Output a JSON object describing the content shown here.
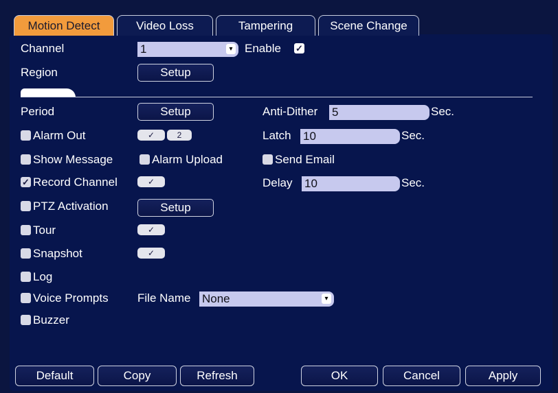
{
  "tabs": [
    "Motion Detect",
    "Video Loss",
    "Tampering",
    "Scene Change"
  ],
  "labels": {
    "channel": "Channel",
    "enable": "Enable",
    "region": "Region",
    "period": "Period",
    "anti_dither": "Anti-Dither",
    "latch": "Latch",
    "delay": "Delay",
    "sec": "Sec.",
    "file_name": "File Name"
  },
  "values": {
    "channel": "1",
    "anti_dither": "5",
    "latch": "10",
    "delay": "10",
    "file_name": "None",
    "alarm_out_number": "2"
  },
  "buttons": {
    "setup": "Setup"
  },
  "checkboxes": {
    "alarm_out": "Alarm Out",
    "show_message": "Show Message",
    "alarm_upload": "Alarm Upload",
    "send_email": "Send Email",
    "record_channel": "Record Channel",
    "ptz_activation": "PTZ Activation",
    "tour": "Tour",
    "snapshot": "Snapshot",
    "log": "Log",
    "voice_prompts": "Voice Prompts",
    "buzzer": "Buzzer"
  },
  "checked": {
    "enable": true,
    "record_channel": true
  },
  "glyphs": {
    "check": "✓",
    "dropdown": "▾"
  },
  "bottom": {
    "default": "Default",
    "copy": "Copy",
    "refresh": "Refresh",
    "ok": "OK",
    "cancel": "Cancel",
    "apply": "Apply"
  },
  "colors": {
    "background": "#07154d",
    "active_tab": "#f29b3c",
    "input_fill": "#c7c9ee"
  }
}
